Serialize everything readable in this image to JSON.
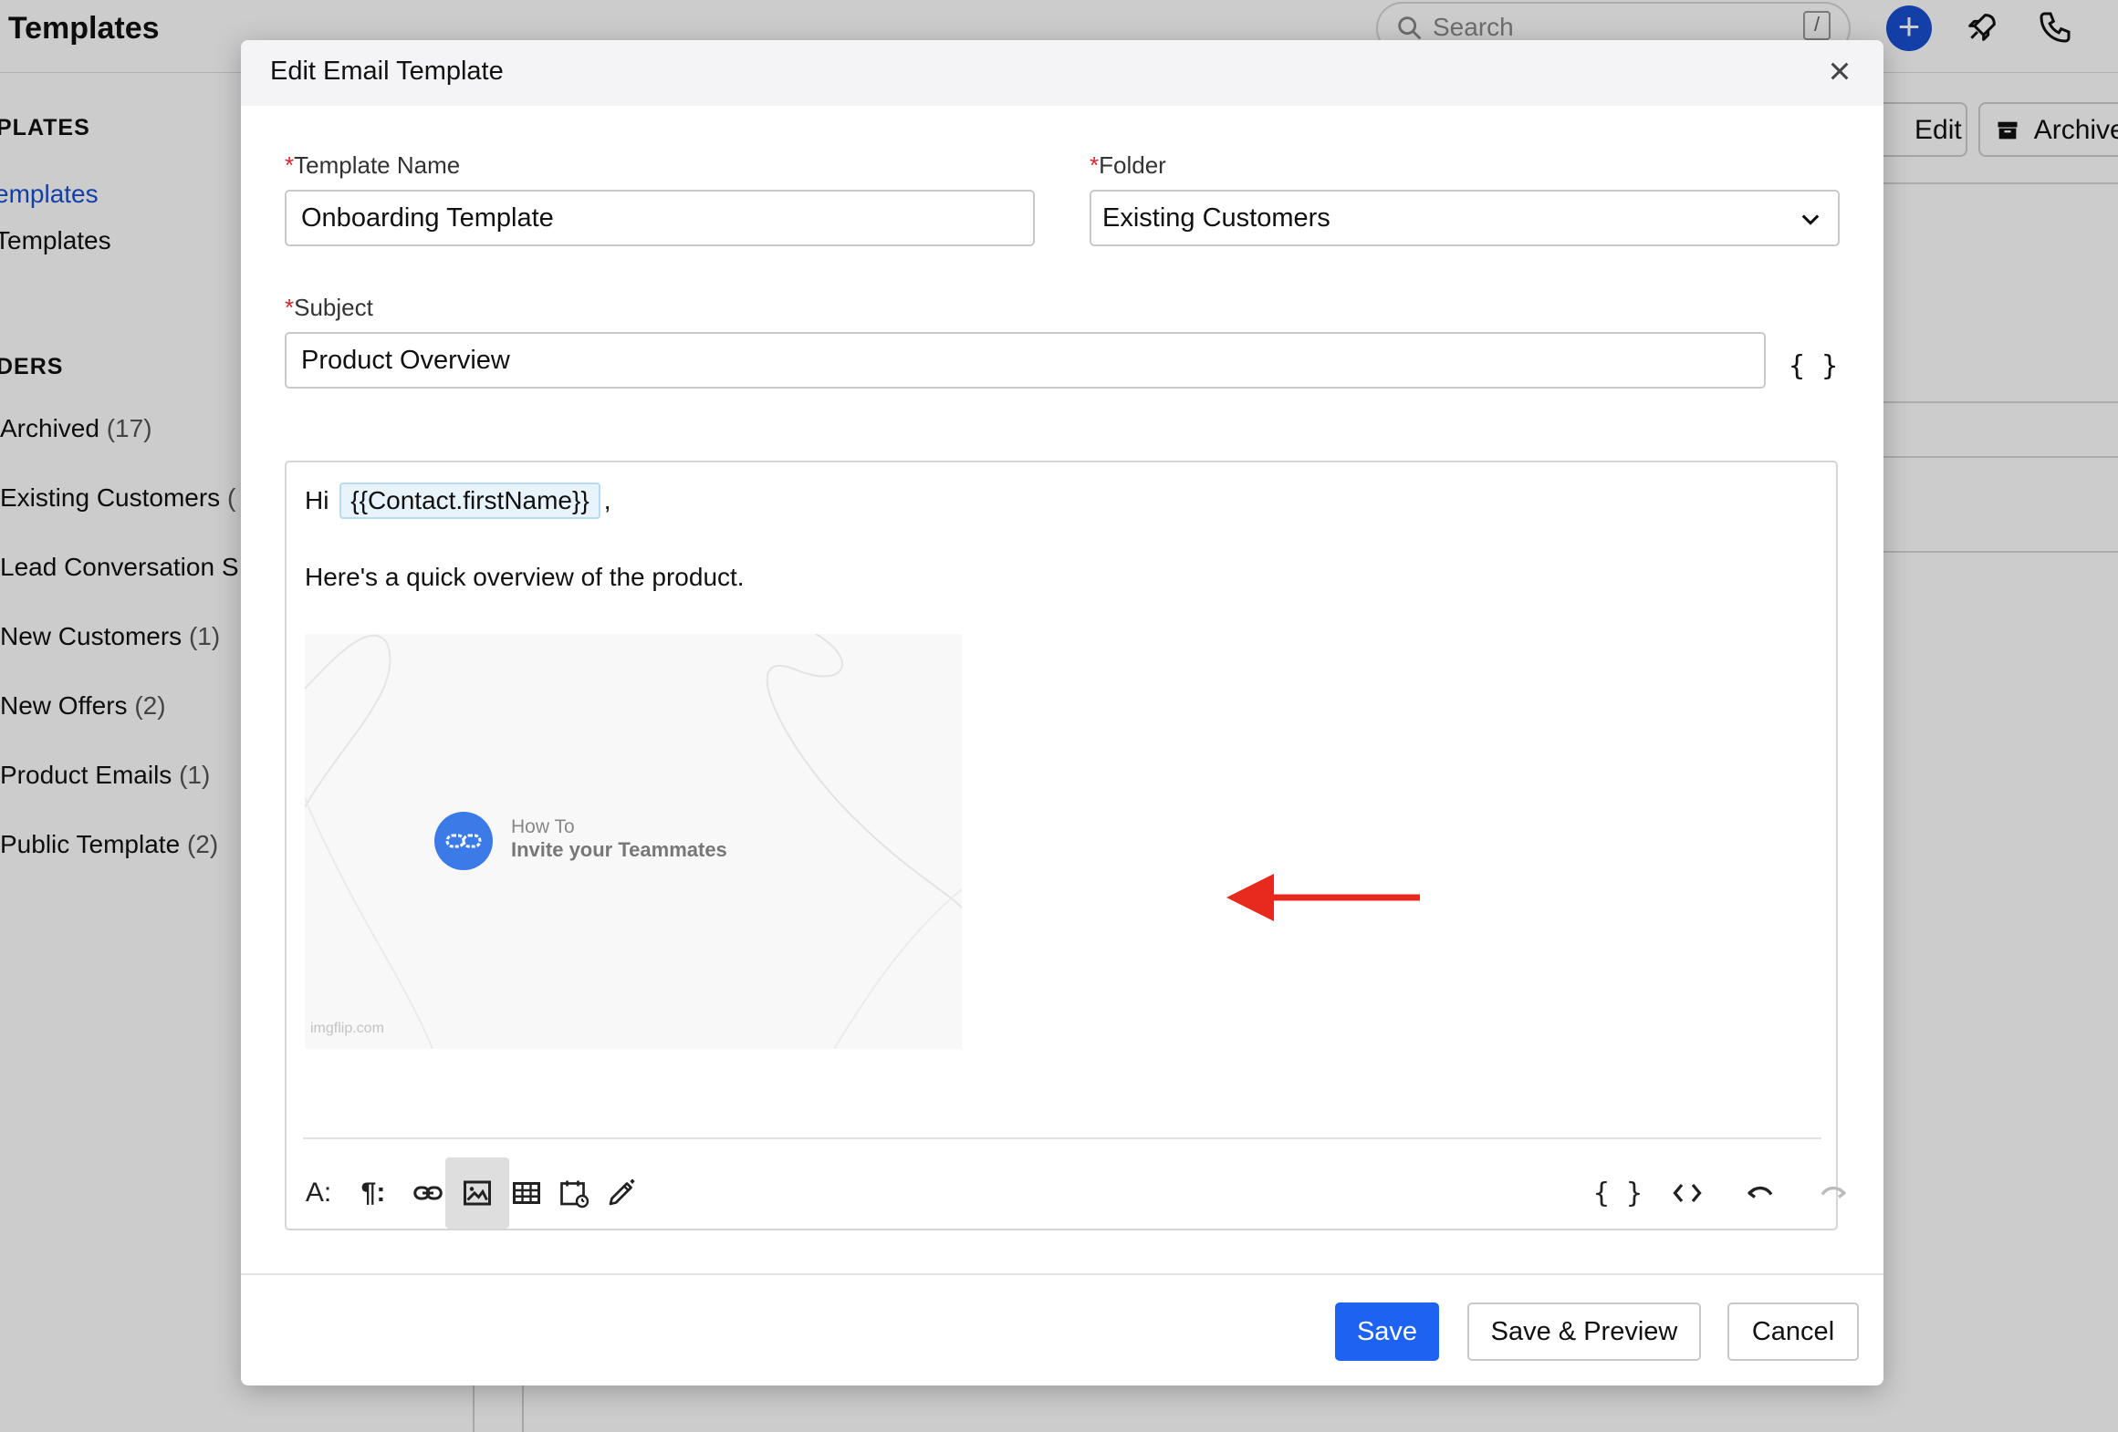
{
  "background": {
    "page_title": "l Templates",
    "search_placeholder": "Search",
    "search_shortcut": "/",
    "sidebar": {
      "section_templates": "PLATES",
      "items_top": [
        "emplates",
        "Templates"
      ],
      "section_folders": "DERS",
      "folders": [
        {
          "name": "Archived",
          "count": "(17)"
        },
        {
          "name": "Existing Customers",
          "count": "("
        },
        {
          "name": "Lead Conversation S",
          "count": ""
        },
        {
          "name": "New Customers",
          "count": "(1)"
        },
        {
          "name": "New Offers",
          "count": "(2)"
        },
        {
          "name": "Product Emails",
          "count": "(1)"
        },
        {
          "name": "Public Template",
          "count": "(2)"
        }
      ]
    },
    "edit_label": "Edit",
    "archive_label": "Archive"
  },
  "modal": {
    "title": "Edit Email Template",
    "template_name": {
      "label": "Template Name",
      "required": "*",
      "value": "Onboarding Template"
    },
    "folder": {
      "label": "Folder",
      "required": "*",
      "value": "Existing Customers"
    },
    "subject": {
      "label": "Subject",
      "required": "*",
      "value": "Product Overview"
    },
    "merge_fields_symbol": "{ }",
    "editor": {
      "greeting": "Hi",
      "merge_chip": "{{Contact.firstName}}",
      "greeting_suffix": ",",
      "body_line": "Here's a quick overview of the product.",
      "video": {
        "small_text": "How To",
        "big_text": "Invite your Teammates",
        "watermark": "imgflip.com"
      },
      "toolbar": {
        "font": "A:",
        "paragraph": "¶:",
        "merge": "{ }",
        "code": "< >"
      }
    },
    "buttons": {
      "save": "Save",
      "save_preview": "Save & Preview",
      "cancel": "Cancel"
    },
    "colors": {
      "primary": "#1d62f0",
      "required": "#d9232d",
      "annotation_arrow": "#e8291e"
    }
  }
}
